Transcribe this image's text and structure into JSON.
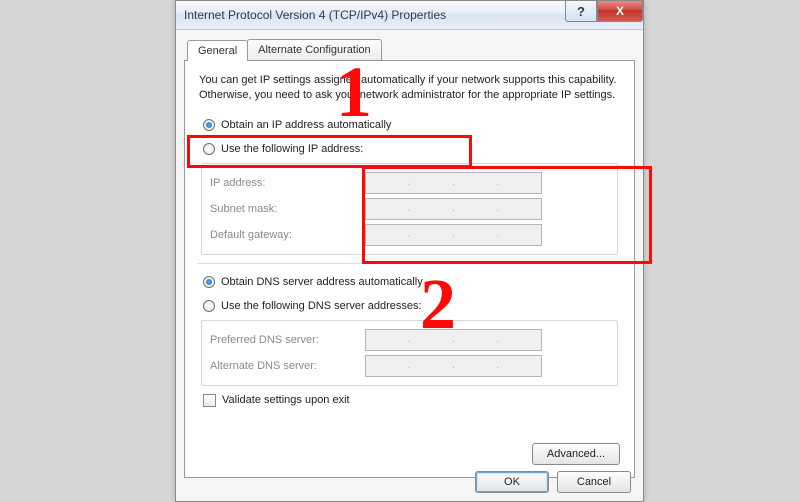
{
  "window": {
    "title": "Internet Protocol Version 4 (TCP/IPv4) Properties",
    "help": "?",
    "close": "X"
  },
  "tabs": {
    "general": "General",
    "alt": "Alternate Configuration"
  },
  "intro": "You can get IP settings assigned automatically if your network supports this capability. Otherwise, you need to ask your network administrator for the appropriate IP settings.",
  "ip": {
    "auto": "Obtain an IP address automatically",
    "manual": "Use the following IP address:",
    "ip_label": "IP address:",
    "mask_label": "Subnet mask:",
    "gw_label": "Default gateway:"
  },
  "dns": {
    "auto": "Obtain DNS server address automatically",
    "manual": "Use the following DNS server addresses:",
    "pref_label": "Preferred DNS server:",
    "alt_label": "Alternate DNS server:"
  },
  "validate": "Validate settings upon exit",
  "buttons": {
    "advanced": "Advanced...",
    "ok": "OK",
    "cancel": "Cancel"
  },
  "annotations": {
    "one": "1",
    "two": "2"
  }
}
